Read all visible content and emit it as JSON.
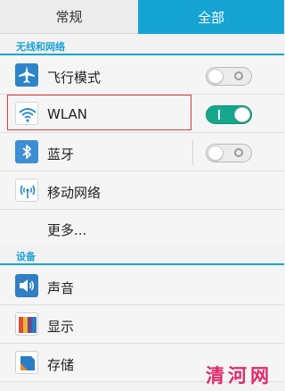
{
  "tabs": {
    "normal": "常规",
    "all": "全部"
  },
  "sections": {
    "wireless": "无线和网络",
    "device": "设备"
  },
  "rows": {
    "airplane": {
      "label": "飞行模式",
      "toggle": "off"
    },
    "wlan": {
      "label": "WLAN",
      "toggle": "on"
    },
    "bluetooth": {
      "label": "蓝牙",
      "toggle": "off"
    },
    "mobile_network": {
      "label": "移动网络"
    },
    "more": {
      "label": "更多..."
    },
    "sound": {
      "label": "声音"
    },
    "display": {
      "label": "显示"
    },
    "storage": {
      "label": "存储"
    }
  },
  "watermark": "清河网",
  "colors": {
    "accent": "#1aa3d4",
    "tab_active": "#15a3d2",
    "toggle_on": "#14a78c",
    "highlight": "#d63b3b",
    "watermark": "#e0296b"
  }
}
